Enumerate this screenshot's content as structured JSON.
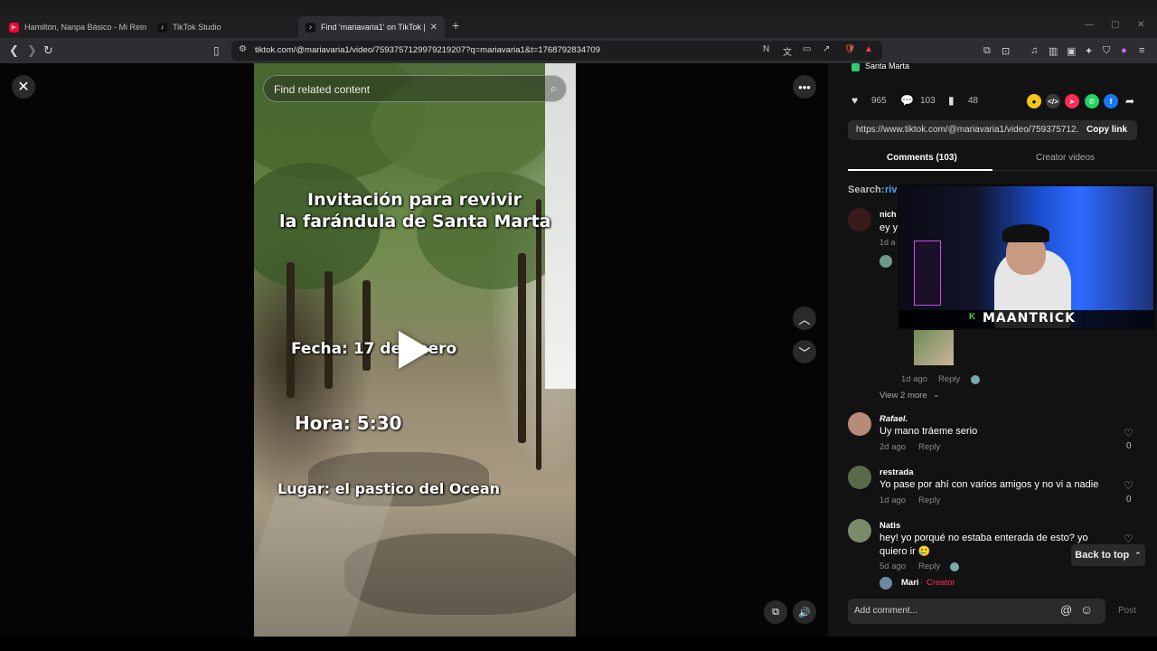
{
  "browser": {
    "tabs": [
      {
        "title": "Hamilton, Nanpa Básico - Mi Reina (V",
        "favicon_color": "#ff0033"
      },
      {
        "title": "TikTok Studio",
        "favicon_color": "#111111"
      },
      {
        "title": "Find 'mariavaria1' on TikTok | Tik",
        "favicon_color": "#111111",
        "active": true
      }
    ],
    "new_tab": "+",
    "url": "tiktok.com/@mariavaria1/video/7593757129979219207?q=mariavaria1&t=1768792834709"
  },
  "video": {
    "search_placeholder": "Find related content",
    "overlay_lines": [
      "Invitación para revivir",
      "la farándula de Santa Marta",
      "Fecha: 17 de enero",
      "Hora: 5:30",
      "Lugar: el pastico del Ocean"
    ]
  },
  "panel": {
    "location": "Santa Marta",
    "stats": {
      "likes": "965",
      "comments": "103",
      "saves": "48"
    },
    "share_colors": [
      "#f5c518",
      "#3a3a3a",
      "#fe2c55",
      "#25d366",
      "#1877f2"
    ],
    "link": "https://www.tiktok.com/@mariavaria1/video/759375712...",
    "copy_link": "Copy link",
    "tabs": [
      "Comments (103)",
      "Creator videos"
    ],
    "search_prefix": "Search:",
    "search_term": "riv",
    "first_comment": {
      "user": "nich",
      "text": "ey y",
      "time": "1d a"
    },
    "reply_meta": {
      "time": "1d ago",
      "reply": "Reply"
    },
    "view_more": "View 2 more",
    "comments": [
      {
        "user": "Rafael.",
        "text": "Uy mano tráeme serio",
        "time": "2d ago",
        "reply": "Reply",
        "likes": "0"
      },
      {
        "user": "restrada",
        "text": "Yo pase por ahí con varios amigos y no vi a nadie",
        "time": "1d ago",
        "reply": "Reply",
        "likes": "0"
      },
      {
        "user": "Natis",
        "text": "hey! yo porqué no estaba enterada de esto? yo",
        "text2": "quiero ir 🥲",
        "time": "5d ago",
        "reply": "Reply"
      }
    ],
    "creator_reply": {
      "user": "Mari",
      "sep": " · ",
      "badge": "Creator"
    },
    "back_to_top": "Back to top",
    "comment_placeholder": "Add comment...",
    "post": "Post"
  },
  "webcam": {
    "label": "MAANTRICK"
  }
}
